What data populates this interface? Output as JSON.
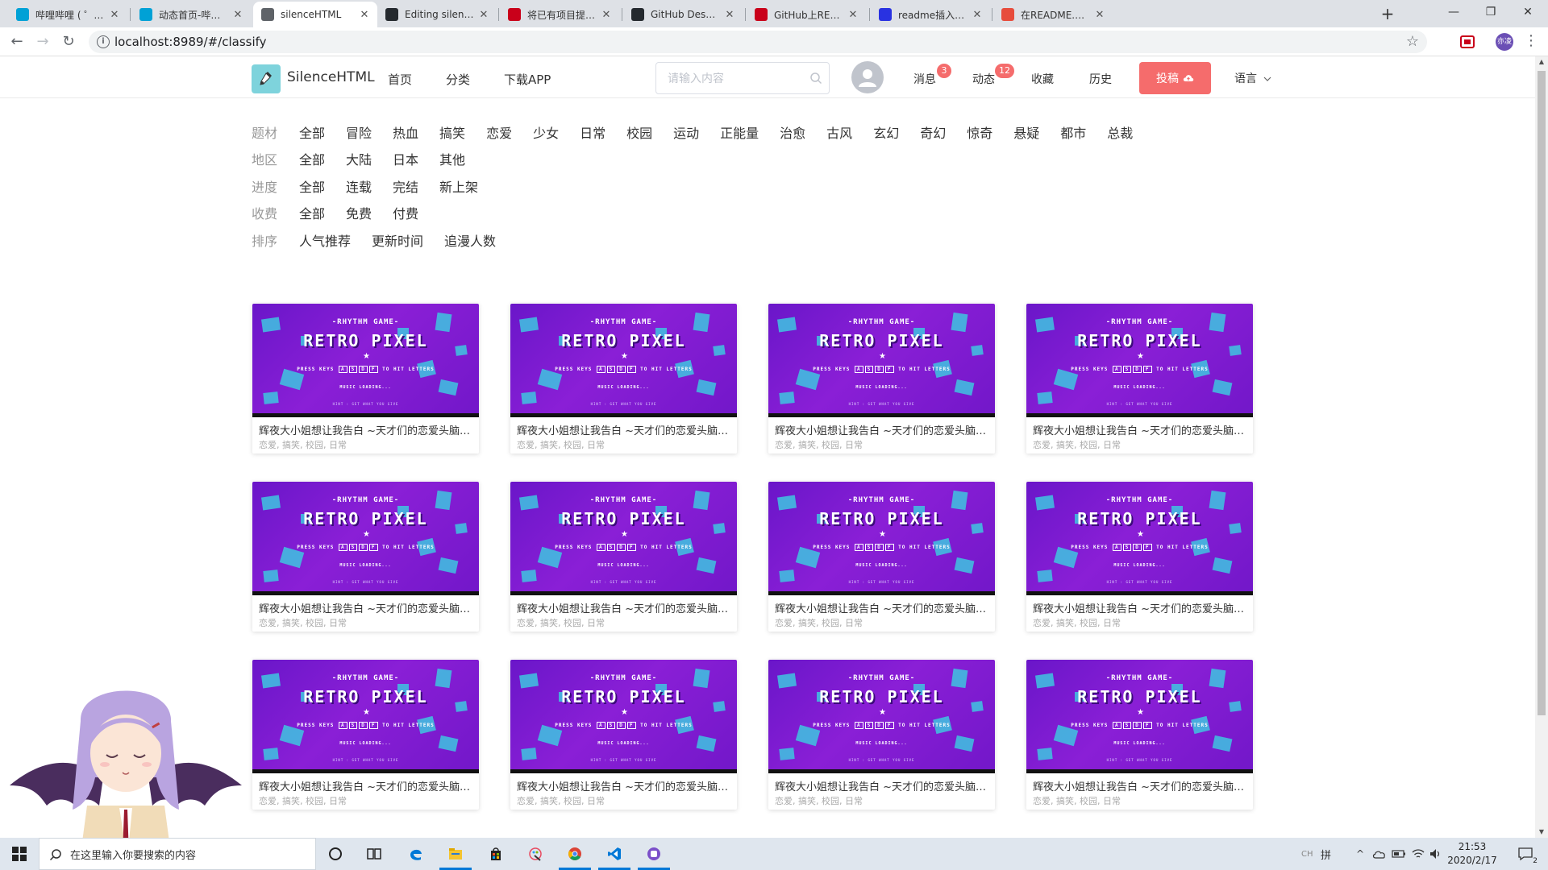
{
  "browser": {
    "tabs": [
      {
        "title": "哔哩哔哩 ( ゜- ゜)つロ 干杯~",
        "favicon_color": "#00a1d6"
      },
      {
        "title": "动态首页-哔哩哔哩",
        "favicon_color": "#00a1d6"
      },
      {
        "title": "silenceHTML",
        "favicon_color": "#5f6368",
        "active": true
      },
      {
        "title": "Editing silence_front/README",
        "favicon_color": "#24292e"
      },
      {
        "title": "将已有项目提交到github",
        "favicon_color": "#c9001a"
      },
      {
        "title": "GitHub Desktop | Simple",
        "favicon_color": "#24292e"
      },
      {
        "title": "GitHub上README.md",
        "favicon_color": "#c9001a"
      },
      {
        "title": "readme插入图片_百度",
        "favicon_color": "#2932e1"
      },
      {
        "title": "在README.md中插入",
        "favicon_color": "#e74c3c"
      }
    ],
    "new_tab_label": "+",
    "window_controls": {
      "minimize": "—",
      "maximize": "❐",
      "close": "✕"
    },
    "url": "localhost:8989/#/classify",
    "profile_label": "亦凌"
  },
  "site": {
    "logo_text": "SilenceHTML",
    "nav": [
      "首页",
      "分类",
      "下载APP"
    ],
    "search_placeholder": "请输入内容",
    "links": {
      "messages": {
        "label": "消息",
        "badge": "3"
      },
      "dynamics": {
        "label": "动态",
        "badge": "12"
      },
      "favorites": {
        "label": "收藏"
      },
      "history": {
        "label": "历史"
      }
    },
    "post_button": "投稿",
    "language": "语言"
  },
  "filters": [
    {
      "label": "题材",
      "options": [
        "全部",
        "冒险",
        "热血",
        "搞笑",
        "恋爱",
        "少女",
        "日常",
        "校园",
        "运动",
        "正能量",
        "治愈",
        "古风",
        "玄幻",
        "奇幻",
        "惊奇",
        "悬疑",
        "都市",
        "总裁"
      ]
    },
    {
      "label": "地区",
      "options": [
        "全部",
        "大陆",
        "日本",
        "其他"
      ]
    },
    {
      "label": "进度",
      "options": [
        "全部",
        "连载",
        "完结",
        "新上架"
      ]
    },
    {
      "label": "收费",
      "options": [
        "全部",
        "免费",
        "付费"
      ]
    },
    {
      "label": "排序",
      "options": [
        "人气推荐",
        "更新时间",
        "追漫人数"
      ]
    }
  ],
  "thumbnail": {
    "line1": "-RHYTHM GAME-",
    "line2": "RETRO PIXEL",
    "line3_prefix": "PRESS KEYS",
    "keys": [
      "A",
      "S",
      "D",
      "F"
    ],
    "line3_suffix": "TO HIT LETTERS",
    "line4": "MUSIC LOADING...",
    "line5": "HINT : GET WHAT YOU GIVE"
  },
  "cards": [
    {
      "title": "辉夜大小姐想让我告白 ~天才们的恋爱头脑战~",
      "tags": "恋爱, 搞笑, 校园, 日常"
    },
    {
      "title": "辉夜大小姐想让我告白 ~天才们的恋爱头脑战~",
      "tags": "恋爱, 搞笑, 校园, 日常"
    },
    {
      "title": "辉夜大小姐想让我告白 ~天才们的恋爱头脑战~",
      "tags": "恋爱, 搞笑, 校园, 日常"
    },
    {
      "title": "辉夜大小姐想让我告白 ~天才们的恋爱头脑战~",
      "tags": "恋爱, 搞笑, 校园, 日常"
    },
    {
      "title": "辉夜大小姐想让我告白 ~天才们的恋爱头脑战~",
      "tags": "恋爱, 搞笑, 校园, 日常"
    },
    {
      "title": "辉夜大小姐想让我告白 ~天才们的恋爱头脑战~",
      "tags": "恋爱, 搞笑, 校园, 日常"
    },
    {
      "title": "辉夜大小姐想让我告白 ~天才们的恋爱头脑战~",
      "tags": "恋爱, 搞笑, 校园, 日常"
    },
    {
      "title": "辉夜大小姐想让我告白 ~天才们的恋爱头脑战~",
      "tags": "恋爱, 搞笑, 校园, 日常"
    },
    {
      "title": "辉夜大小姐想让我告白 ~天才们的恋爱头脑战~",
      "tags": "恋爱, 搞笑, 校园, 日常"
    },
    {
      "title": "辉夜大小姐想让我告白 ~天才们的恋爱头脑战~",
      "tags": "恋爱, 搞笑, 校园, 日常"
    },
    {
      "title": "辉夜大小姐想让我告白 ~天才们的恋爱头脑战~",
      "tags": "恋爱, 搞笑, 校园, 日常"
    },
    {
      "title": "辉夜大小姐想让我告白 ~天才们的恋爱头脑战~",
      "tags": "恋爱, 搞笑, 校园, 日常"
    }
  ],
  "taskbar": {
    "search_placeholder": "在这里输入你要搜索的内容",
    "apps": [
      "cortana-icon",
      "task-view-icon",
      "edge-icon",
      "file-explorer-icon",
      "store-icon",
      "paint-icon",
      "chrome-icon",
      "vscode-icon",
      "app-icon"
    ],
    "ime": "CH",
    "ime_mode": "拼",
    "time": "21:53",
    "date": "2020/2/17",
    "notification_count": "2"
  },
  "colors": {
    "accent_red": "#f56c6c",
    "logo_bg": "#7ed3dc",
    "thumb_purple": "#7a1bd0",
    "thumb_cyan": "#3ec6e0"
  }
}
